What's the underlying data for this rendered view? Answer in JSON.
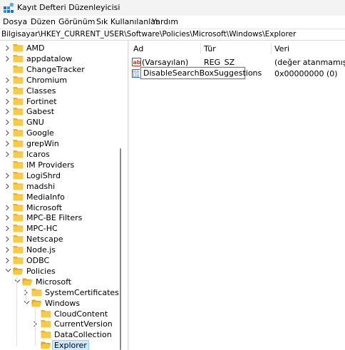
{
  "window": {
    "title": "Kayıt Defteri Düzenleyicisi"
  },
  "menu": [
    "Dosya",
    "Düzen",
    "Görünüm",
    "Sık Kullanılanlar",
    "Yardım"
  ],
  "address": "Bilgisayar\\HKEY_CURRENT_USER\\Software\\Policies\\Microsoft\\Windows\\Explorer",
  "tree": [
    {
      "label": "AMD",
      "expander": "collapsed"
    },
    {
      "label": "appdatalow",
      "expander": "collapsed"
    },
    {
      "label": "ChangeTracker",
      "expander": "none"
    },
    {
      "label": "Chromium",
      "expander": "collapsed"
    },
    {
      "label": "Classes",
      "expander": "collapsed"
    },
    {
      "label": "Fortinet",
      "expander": "collapsed"
    },
    {
      "label": "Gabest",
      "expander": "collapsed"
    },
    {
      "label": "GNU",
      "expander": "collapsed"
    },
    {
      "label": "Google",
      "expander": "collapsed"
    },
    {
      "label": "grepWin",
      "expander": "collapsed"
    },
    {
      "label": "Icaros",
      "expander": "collapsed"
    },
    {
      "label": "IM Providers",
      "expander": "none"
    },
    {
      "label": "LogiShrd",
      "expander": "collapsed"
    },
    {
      "label": "madshi",
      "expander": "collapsed"
    },
    {
      "label": "MediaInfo",
      "expander": "none"
    },
    {
      "label": "Microsoft",
      "expander": "collapsed"
    },
    {
      "label": "MPC-BE Filters",
      "expander": "collapsed"
    },
    {
      "label": "MPC-HC",
      "expander": "collapsed"
    },
    {
      "label": "Netscape",
      "expander": "collapsed"
    },
    {
      "label": "Node.js",
      "expander": "collapsed"
    },
    {
      "label": "ODBC",
      "expander": "collapsed"
    },
    {
      "label": "Policies",
      "expander": "expanded"
    },
    {
      "label": "Microsoft",
      "expander": "expanded"
    },
    {
      "label": "SystemCertificates",
      "expander": "collapsed"
    },
    {
      "label": "Windows",
      "expander": "expanded"
    },
    {
      "label": "CloudContent",
      "expander": "none"
    },
    {
      "label": "CurrentVersion",
      "expander": "collapsed"
    },
    {
      "label": "DataCollection",
      "expander": "none"
    },
    {
      "label": "Explorer",
      "expander": "none"
    }
  ],
  "columns": {
    "name": "Ad",
    "type": "Tür",
    "data": "Veri"
  },
  "values": [
    {
      "icon": "ab-string-icon",
      "name": "(Varsayılan)",
      "type": "REG_SZ",
      "data": "(değer atanmamış)"
    },
    {
      "icon": "binary-dword-icon",
      "name": "DisableSearchBoxSuggestions",
      "type": "",
      "data": "0x00000000 (0)"
    }
  ],
  "colors": {
    "folder": "#f1c232",
    "selection": "#cce8ff",
    "title_icon": "#1e73be"
  }
}
